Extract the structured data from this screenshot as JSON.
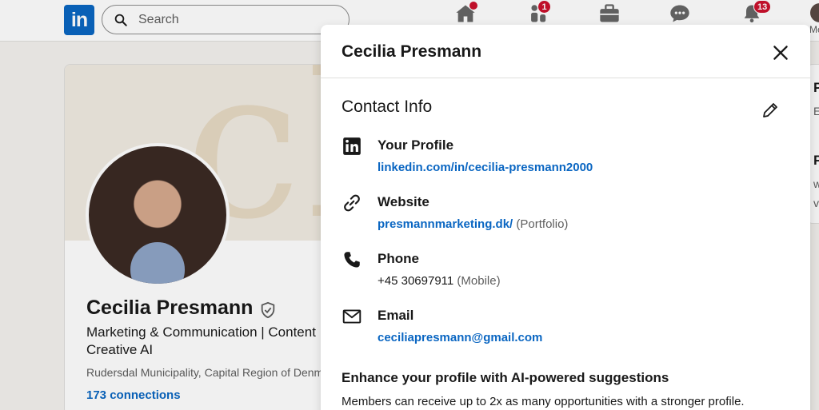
{
  "nav": {
    "logo_text": "in",
    "search_placeholder": "Search",
    "icons": [
      {
        "name": "home-icon",
        "badge": ""
      },
      {
        "name": "my-network-icon",
        "badge": "1"
      },
      {
        "name": "jobs-icon",
        "badge": ""
      },
      {
        "name": "messaging-icon",
        "badge": ""
      },
      {
        "name": "notifications-icon",
        "badge": "13"
      }
    ],
    "me_label": "Me"
  },
  "profile": {
    "name": "Cecilia Presmann",
    "headline": "Marketing & Communication | Content Creative AI",
    "location": "Rudersdal Municipality, Capital Region of Denmark",
    "connections": "173 connections"
  },
  "side": {
    "p1": "P",
    "p1_sub": "E",
    "p2": "P",
    "p2_sub1": "w",
    "p2_sub2": "v"
  },
  "modal": {
    "title": "Cecilia Presmann",
    "section_title": "Contact Info",
    "items": [
      {
        "icon": "linkedin-icon",
        "label": "Your Profile",
        "value": "linkedin.com/in/cecilia-presmann2000",
        "qualifier": ""
      },
      {
        "icon": "link-icon",
        "label": "Website",
        "value": "presmannmarketing.dk/",
        "qualifier": "(Portfolio)"
      },
      {
        "icon": "phone-icon",
        "label": "Phone",
        "value": "+45 30697911",
        "qualifier": "(Mobile)"
      },
      {
        "icon": "email-icon",
        "label": "Email",
        "value": "ceciliapresmann@gmail.com",
        "qualifier": ""
      }
    ],
    "enhance_title": "Enhance your profile with AI-powered suggestions",
    "enhance_text": "Members can receive up to 2x as many opportunities with a stronger profile."
  },
  "colors": {
    "brand": "#0a66c2",
    "badge": "#cb112d",
    "text": "#191919",
    "muted": "#5e5e5e"
  }
}
